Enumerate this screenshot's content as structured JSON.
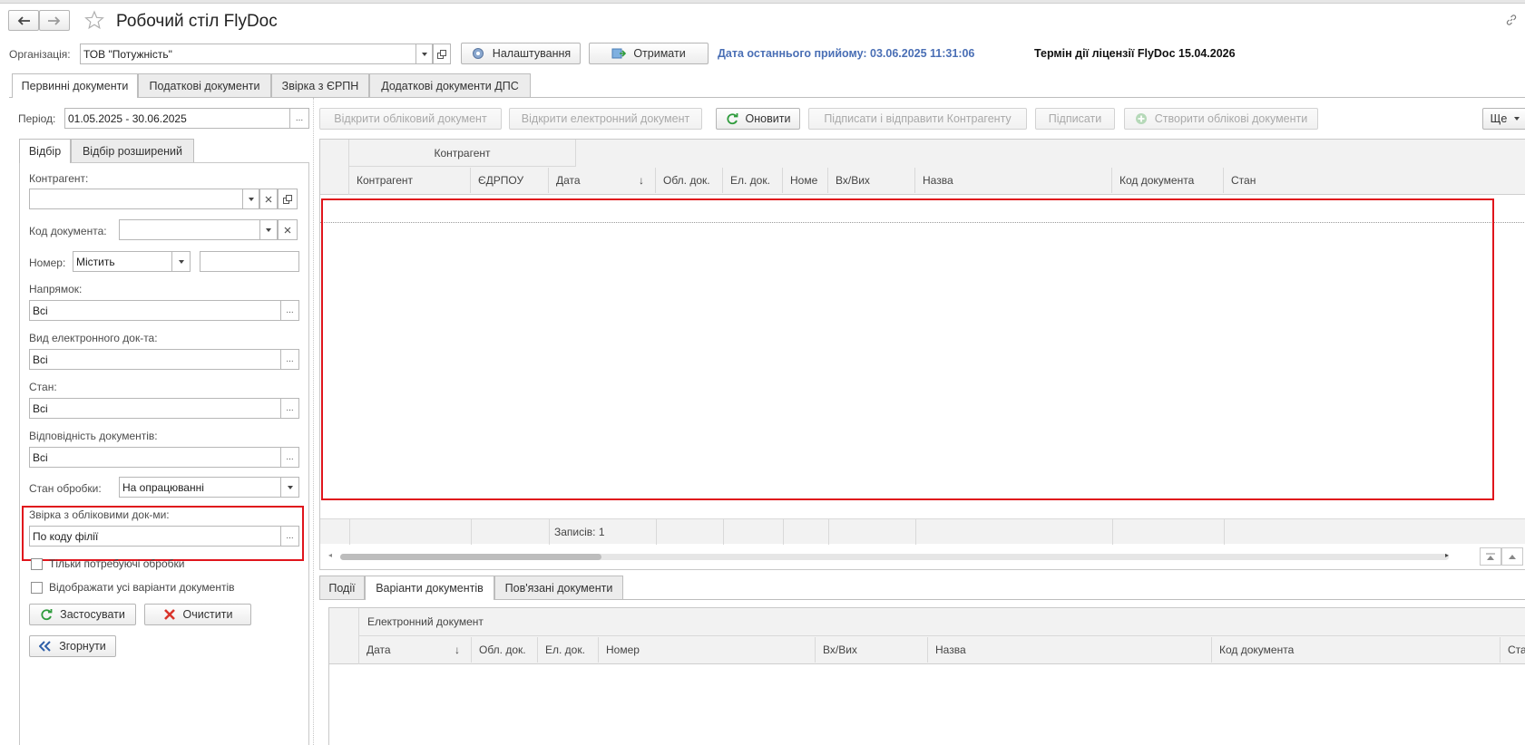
{
  "title": "Робочий стіл FlyDoc",
  "org": {
    "label": "Організація:",
    "value": "ТОВ \"Потужність\"",
    "settings_label": "Налаштування",
    "receive_label": "Отримати",
    "last_receive": "Дата останнього прийому: 03.06.2025 11:31:06",
    "license": "Термін дії ліцензії FlyDoc 15.04.2026"
  },
  "main_tabs": [
    "Первинні документи",
    "Податкові документи",
    "Звірка з ЄРПН",
    "Додаткові документи ДПС"
  ],
  "filter": {
    "period_label": "Період:",
    "period_value": "01.05.2025 - 30.06.2025",
    "tabs": [
      "Відбір",
      "Відбір розширений"
    ],
    "counterparty_label": "Контрагент:",
    "doc_code_label": "Код документа:",
    "number_label": "Номер:",
    "number_mode": "Містить",
    "direction_label": "Напрямок:",
    "direction_value": "Всі",
    "edoc_type_label": "Вид електронного док-та:",
    "edoc_type_value": "Всі",
    "state_label": "Стан:",
    "state_value": "Всі",
    "match_label": "Відповідність документів:",
    "match_value": "Всі",
    "processing_label": "Стан обробки:",
    "processing_value": "На опрацюванні",
    "reconcile_label": "Звірка з обліковими док-ми:",
    "reconcile_value": "По коду філії",
    "only_needing_label": "Тільки потребуючі обробки",
    "show_all_label": "Відображати усі варіанти документів",
    "apply_label": "Застосувати",
    "clear_label": "Очистити",
    "collapse_label": "Згорнути",
    "ellipsis": "..."
  },
  "toolbar": {
    "open_account_doc": "Відкрити обліковий документ",
    "open_e_doc": "Відкрити електронний документ",
    "refresh": "Оновити",
    "sign_send": "Підписати і відправити Контрагенту",
    "sign": "Підписати",
    "create_docs": "Створити облікові документи",
    "more": "Ще"
  },
  "grid": {
    "group_header": "Контрагент",
    "columns": [
      "Контрагент",
      "ЄДРПОУ",
      "Дата",
      "Обл. док.",
      "Ел. док.",
      "Номе",
      "Вх/Вих",
      "Назва",
      "Код документа",
      "Стан"
    ],
    "sort_arrow": "↓",
    "records_label": "Записів: 1"
  },
  "bottom_tabs": [
    "Події",
    "Варіанти документів",
    "Пов'язані документи"
  ],
  "bottom_grid": {
    "group_header": "Електронний документ",
    "columns": [
      "Дата",
      "Обл. док.",
      "Ел. док.",
      "Номер",
      "Вх/Вих",
      "Назва",
      "Код документа",
      "Ста"
    ],
    "sort_arrow": "↓"
  },
  "colors": {
    "accent_blue": "#4a6fb5",
    "highlight_red": "#e0151c",
    "green_icon": "#2e9b3c",
    "red_icon": "#d9342b"
  }
}
